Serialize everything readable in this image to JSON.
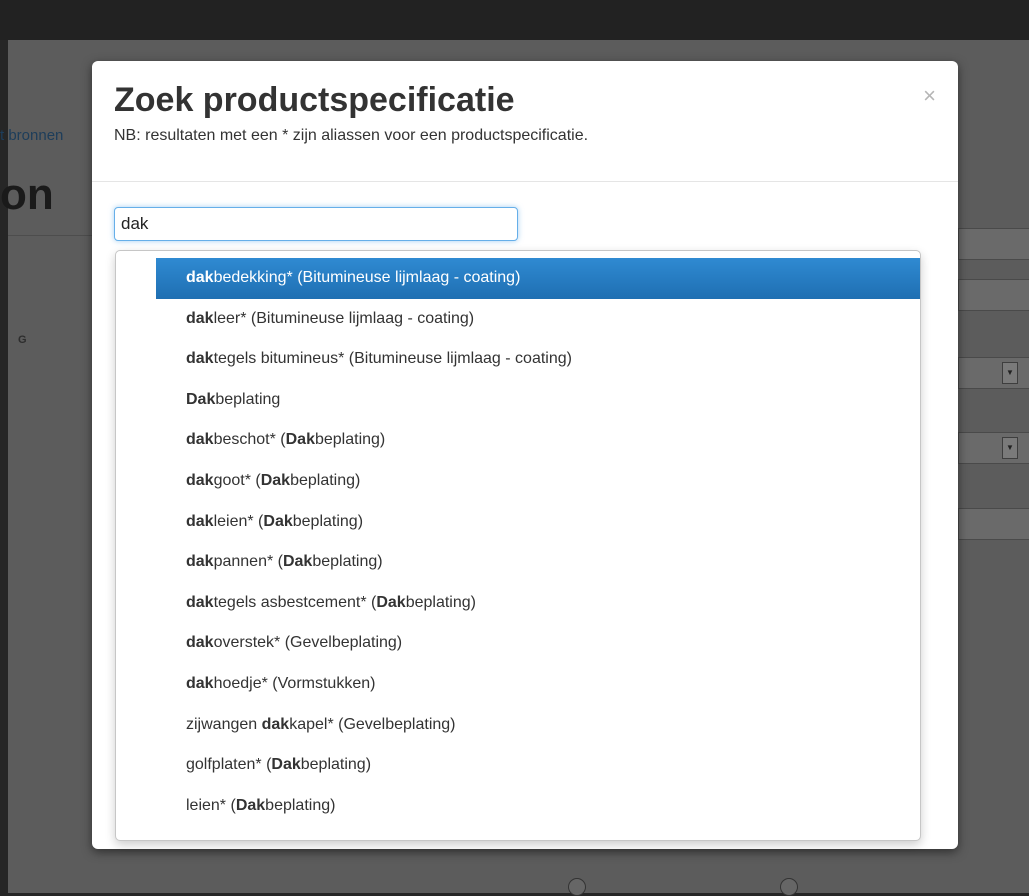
{
  "background": {
    "link_fragment": "t bronnen",
    "heading_fragment": "on",
    "label_fragment": "G"
  },
  "modal": {
    "title": "Zoek productspecificatie",
    "subtitle": "NB: resultaten met een * zijn aliassen voor een productspecificatie.",
    "close_symbol": "×",
    "search_value": "dak"
  },
  "results": [
    {
      "segments": [
        {
          "t": "dak",
          "b": true
        },
        {
          "t": "bedekking* (Bitumineuse lijmlaag - coating)",
          "b": false
        }
      ],
      "active": true
    },
    {
      "segments": [
        {
          "t": "dak",
          "b": true
        },
        {
          "t": "leer* (Bitumineuse lijmlaag - coating)",
          "b": false
        }
      ]
    },
    {
      "segments": [
        {
          "t": "dak",
          "b": true
        },
        {
          "t": "tegels bitumineus* (Bitumineuse lijmlaag - coating)",
          "b": false
        }
      ]
    },
    {
      "segments": [
        {
          "t": "Dak",
          "b": true
        },
        {
          "t": "beplating",
          "b": false
        }
      ]
    },
    {
      "segments": [
        {
          "t": "dak",
          "b": true
        },
        {
          "t": "beschot* (",
          "b": false
        },
        {
          "t": "Dak",
          "b": true
        },
        {
          "t": "beplating)",
          "b": false
        }
      ]
    },
    {
      "segments": [
        {
          "t": "dak",
          "b": true
        },
        {
          "t": "goot* (",
          "b": false
        },
        {
          "t": "Dak",
          "b": true
        },
        {
          "t": "beplating)",
          "b": false
        }
      ]
    },
    {
      "segments": [
        {
          "t": "dak",
          "b": true
        },
        {
          "t": "leien* (",
          "b": false
        },
        {
          "t": "Dak",
          "b": true
        },
        {
          "t": "beplating)",
          "b": false
        }
      ]
    },
    {
      "segments": [
        {
          "t": "dak",
          "b": true
        },
        {
          "t": "pannen* (",
          "b": false
        },
        {
          "t": "Dak",
          "b": true
        },
        {
          "t": "beplating)",
          "b": false
        }
      ]
    },
    {
      "segments": [
        {
          "t": "dak",
          "b": true
        },
        {
          "t": "tegels asbestcement* (",
          "b": false
        },
        {
          "t": "Dak",
          "b": true
        },
        {
          "t": "beplating)",
          "b": false
        }
      ]
    },
    {
      "segments": [
        {
          "t": "dak",
          "b": true
        },
        {
          "t": "overstek* (Gevelbeplating)",
          "b": false
        }
      ]
    },
    {
      "segments": [
        {
          "t": "dak",
          "b": true
        },
        {
          "t": "hoedje* (Vormstukken)",
          "b": false
        }
      ]
    },
    {
      "segments": [
        {
          "t": "zijwangen ",
          "b": false
        },
        {
          "t": "dak",
          "b": true
        },
        {
          "t": "kapel* (Gevelbeplating)",
          "b": false
        }
      ]
    },
    {
      "segments": [
        {
          "t": "golfplaten* (",
          "b": false
        },
        {
          "t": "Dak",
          "b": true
        },
        {
          "t": "beplating)",
          "b": false
        }
      ]
    },
    {
      "segments": [
        {
          "t": "leien* (",
          "b": false
        },
        {
          "t": "Dak",
          "b": true
        },
        {
          "t": "beplating)",
          "b": false
        }
      ]
    }
  ],
  "colors": {
    "active_item_bg": "#2a7fc9",
    "input_focus_border": "#66afe9",
    "overlay": "#5c5c5c"
  }
}
